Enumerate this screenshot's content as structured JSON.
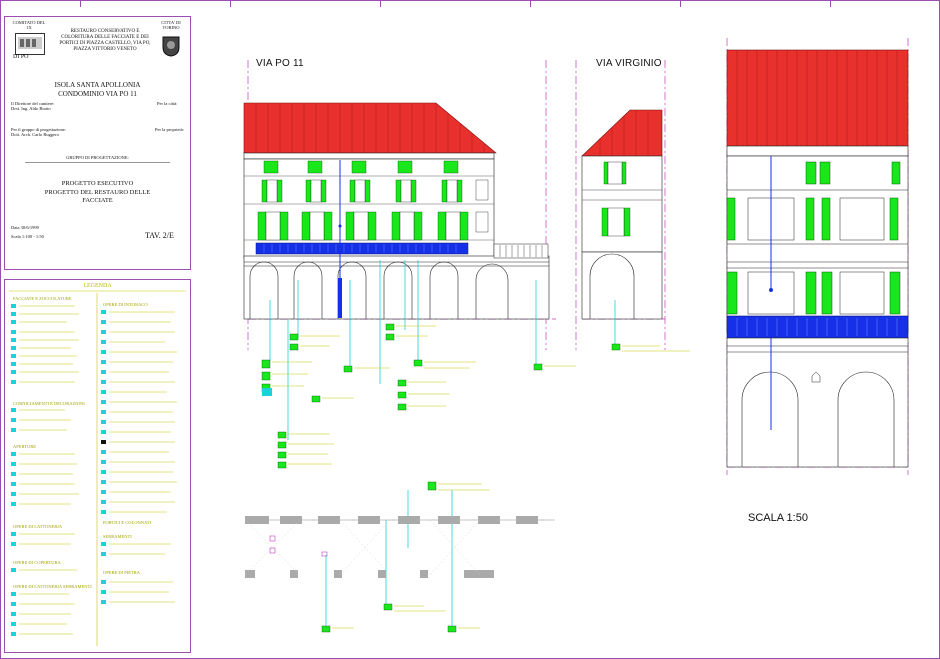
{
  "title_block": {
    "left_logo_caption": "COMITATO DEL 1X",
    "project_header": "RESTAURO CONSERVATIVO E COLORITURA DELLE FACCIATE E DEI PORTICI DI PIAZZA CASTELLO, VIA PO, PIAZZA VITTORIO VENETO",
    "right_logo_caption": "CITTA' DI TORINO",
    "logo_text": "DI PO",
    "building": "ISOLA SANTA APOLLONIA",
    "condominium": "CONDOMINIO VIA PO 11",
    "director_label": "Il Direttore del cantiere:",
    "director_name": "Dott. Ing. Aldo Biotto",
    "city_label": "Per la città:",
    "designers_label": "Per il gruppo di progettazione:",
    "designers_name": "Dott. Arch. Carlo Ruggero",
    "owner_label": "Per la proprietà:",
    "group_label": "GRUPPO DI PROGETTAZIONE:",
    "phase": "PROGETTO ESECUTIVO",
    "subject": "PROGETTO DEL RESTAURO DELLE FACCIATE",
    "date": "Data 30/6/1999",
    "scale_text": "Scala 1:100 - 1:50",
    "sheet_id": "TAV. 2/E"
  },
  "legend": {
    "title": "LEGENDA",
    "left_sections": [
      "FACCIATE E ZOCCOLATURE",
      "CORNICIAMENTI E DECORAZIONI",
      "APERTURE",
      "OPERE DI LATTONERIA",
      "OPERE DI COPERTURA",
      "OPERE DI LATTONERIA SERRAMENTI"
    ],
    "right_sections": [
      "OPERE DI INTONACO",
      "SERRAMENTI",
      "OPERE DI PIETRA",
      "PORTICI E COLONNATI"
    ]
  },
  "drawings": {
    "via_po": "VIA PO 11",
    "via_virginio": "VIA VIRGINIO",
    "scale": "SCALA 1:50"
  },
  "colors": {
    "roof": "#e8302c",
    "shutters": "#19e61b",
    "balcony": "#1630e8",
    "callouts": "#1ad3d8",
    "frame": "#9a4fb0"
  }
}
